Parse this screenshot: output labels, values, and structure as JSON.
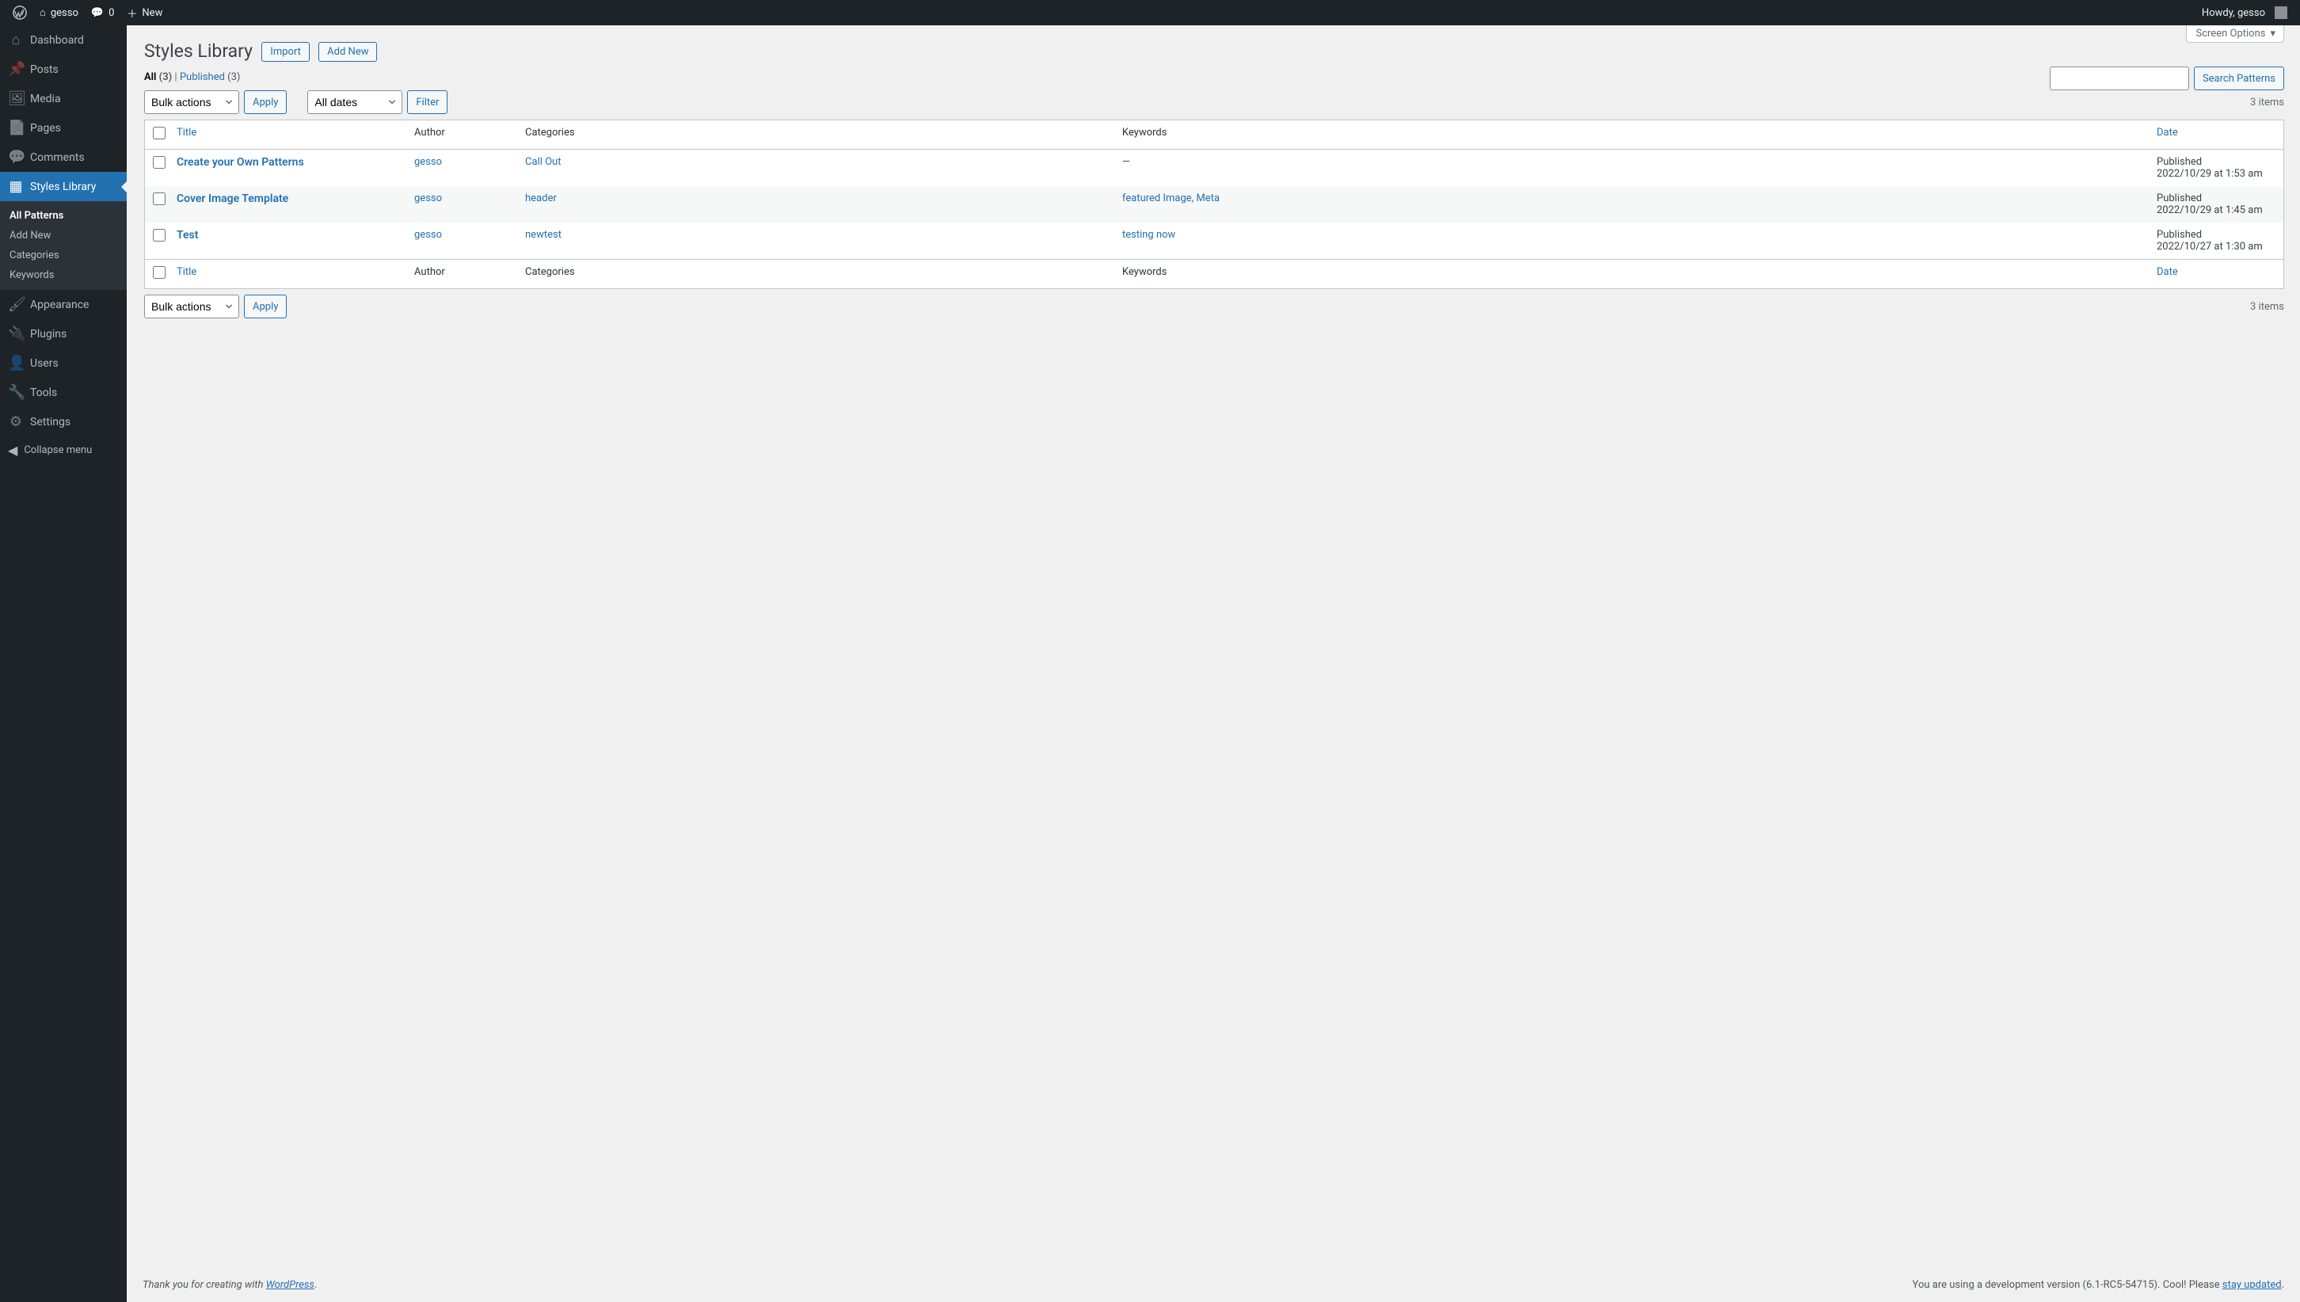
{
  "adminbar": {
    "site_name": "gesso",
    "comments_count": "0",
    "new_label": "New",
    "howdy": "Howdy, gesso"
  },
  "adminmenu": {
    "items": [
      {
        "icon": "⌂",
        "label": "Dashboard"
      },
      {
        "icon": "📌",
        "label": "Posts"
      },
      {
        "icon": "🖼",
        "label": "Media"
      },
      {
        "icon": "📄",
        "label": "Pages"
      },
      {
        "icon": "💬",
        "label": "Comments"
      },
      {
        "icon": "▦",
        "label": "Styles Library",
        "current": true
      },
      {
        "icon": "🖌",
        "label": "Appearance"
      },
      {
        "icon": "🔌",
        "label": "Plugins"
      },
      {
        "icon": "👤",
        "label": "Users"
      },
      {
        "icon": "🔧",
        "label": "Tools"
      },
      {
        "icon": "⚙",
        "label": "Settings"
      }
    ],
    "submenu": [
      {
        "label": "All Patterns",
        "current": true
      },
      {
        "label": "Add New"
      },
      {
        "label": "Categories"
      },
      {
        "label": "Keywords"
      }
    ],
    "collapse_label": "Collapse menu"
  },
  "screen_options": "Screen Options",
  "page_title": "Styles Library",
  "buttons": {
    "import": "Import",
    "add_new": "Add New",
    "apply": "Apply",
    "filter": "Filter",
    "search": "Search Patterns"
  },
  "views": {
    "all_label": "All",
    "all_count": "(3)",
    "sep": " | ",
    "published_label": "Published",
    "published_count": "(3)"
  },
  "bulk_placeholder": "Bulk actions",
  "dates_placeholder": "All dates",
  "item_count": "3 items",
  "columns": {
    "title": "Title",
    "author": "Author",
    "categories": "Categories",
    "keywords": "Keywords",
    "date": "Date"
  },
  "rows": [
    {
      "title": "Create your Own Patterns",
      "author": "gesso",
      "categories": "Call Out",
      "keywords": "—",
      "date_status": "Published",
      "date_value": "2022/10/29 at 1:53 am"
    },
    {
      "title": "Cover Image Template",
      "author": "gesso",
      "categories": "header",
      "keywords": "featured Image, Meta",
      "date_status": "Published",
      "date_value": "2022/10/29 at 1:45 am"
    },
    {
      "title": "Test",
      "author": "gesso",
      "categories": "newtest",
      "keywords": "testing now",
      "date_status": "Published",
      "date_value": "2022/10/27 at 1:30 am"
    }
  ],
  "footer": {
    "thank_pre": "Thank you for creating with ",
    "thank_link": "WordPress",
    "thank_post": ".",
    "version_pre": "You are using a development version (6.1-RC5-54715). Cool! Please ",
    "version_link": "stay updated",
    "version_post": "."
  }
}
